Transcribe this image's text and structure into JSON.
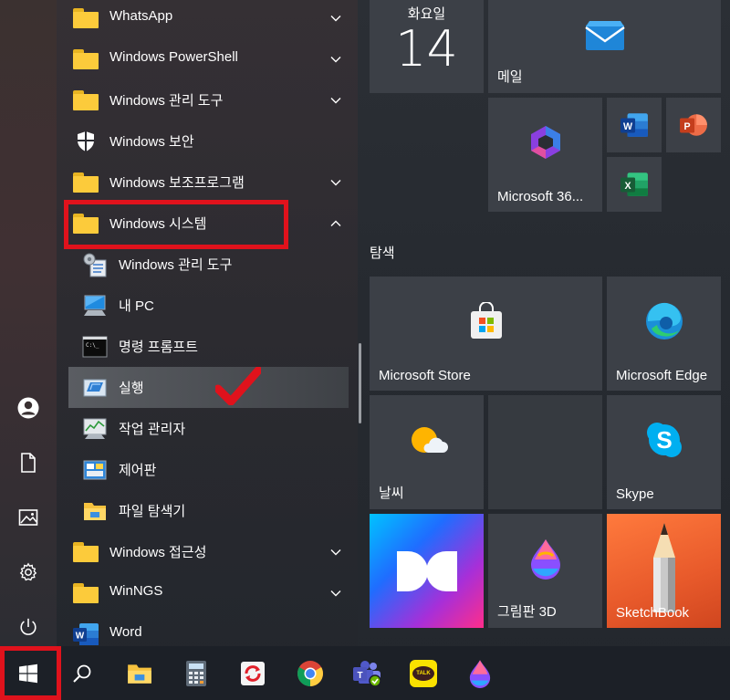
{
  "app_list": {
    "items": [
      {
        "label": "WhatsApp",
        "type": "folder"
      },
      {
        "label": "Windows PowerShell",
        "type": "folder"
      },
      {
        "label": "Windows 관리 도구",
        "type": "folder"
      },
      {
        "label": "Windows 보안",
        "type": "app"
      },
      {
        "label": "Windows 보조프로그램",
        "type": "folder"
      },
      {
        "label": "Windows 시스템",
        "type": "folder-expanded"
      },
      {
        "label": "Windows 관리 도구",
        "type": "sub"
      },
      {
        "label": "내 PC",
        "type": "sub"
      },
      {
        "label": "명령 프롬프트",
        "type": "sub"
      },
      {
        "label": "실행",
        "type": "sub",
        "state": "selected"
      },
      {
        "label": "작업 관리자",
        "type": "sub"
      },
      {
        "label": "제어판",
        "type": "sub"
      },
      {
        "label": "파일 탐색기",
        "type": "sub"
      },
      {
        "label": "Windows 접근성",
        "type": "folder"
      },
      {
        "label": "WinNGS",
        "type": "folder"
      },
      {
        "label": "Word",
        "type": "app"
      }
    ]
  },
  "left_rail": {
    "icons": [
      "user-icon",
      "document-icon",
      "pictures-icon",
      "settings-icon",
      "power-icon"
    ]
  },
  "tiles": {
    "calendar": {
      "day_label": "화요일",
      "date": "14"
    },
    "mail": {
      "label": "메일"
    },
    "office": {
      "label": "Microsoft 36..."
    },
    "explore_group_title": "탐색",
    "store": {
      "label": "Microsoft Store"
    },
    "edge": {
      "label": "Microsoft Edge"
    },
    "weather": {
      "label": "날씨"
    },
    "skype": {
      "label": "Skype"
    },
    "paint3d": {
      "label": "그림판 3D"
    },
    "sketchbook": {
      "label": "SketchBook"
    }
  },
  "taskbar": {
    "items": [
      "start-icon",
      "search-icon",
      "file-explorer-icon",
      "calculator-icon",
      "sync-app-icon",
      "chrome-icon",
      "teams-icon",
      "kakaotalk-icon",
      "paint3d-icon"
    ],
    "kakao_text": "TALK"
  },
  "colors": {
    "highlight_red": "#e0121c",
    "folder_yellow": "#fccb3b",
    "tile_bg": "#3c4047",
    "taskbar_bg": "#1c2027"
  }
}
